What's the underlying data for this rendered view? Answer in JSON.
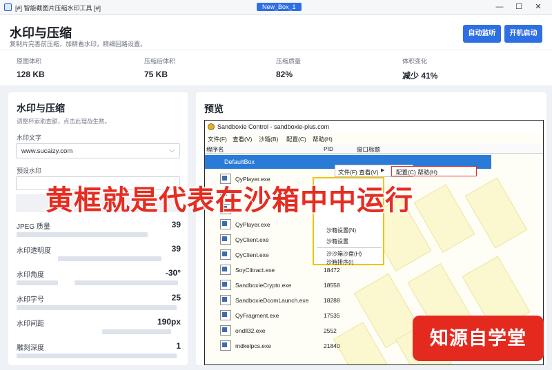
{
  "window": {
    "title": "[#] 智能截图片压缩水印工具 [#]",
    "tab_badge": "New_Box_1",
    "minimize": "—",
    "maximize": "☐",
    "close": "✕"
  },
  "header": {
    "title": "水印与压缩",
    "subtitle": "复制片完善前压缩，加精看水印，精细回路设置。",
    "btn_auto": "自动监听",
    "btn_start": "开机启动"
  },
  "stats": [
    {
      "label": "原图体积",
      "value": "128 KB"
    },
    {
      "label": "压缩后体积",
      "value": "75 KB"
    },
    {
      "label": "压缩质量",
      "value": "82%"
    },
    {
      "label": "体积变化",
      "value": "减少 41%"
    }
  ],
  "left_panel": {
    "title": "水印与压缩",
    "subtitle": "调整杯索助查额，点击此理战生数。",
    "watermark_text_label": "水印文字",
    "watermark_text_value": "www.sucaizy.com",
    "preset_label": "预设水印",
    "rows": [
      {
        "label": "JPEG 质量",
        "value": "39"
      },
      {
        "label": "水印透明度",
        "value": "39"
      },
      {
        "label": "水印角度",
        "value": "-30°"
      },
      {
        "label": "水印字号",
        "value": "25"
      },
      {
        "label": "水印间距",
        "value": "190px"
      },
      {
        "label": "雕刻深度",
        "value": "1"
      }
    ]
  },
  "preview": {
    "title": "预览",
    "sb_title": "Sandboxie Control - sandboxie-plus.com",
    "sb_menu": [
      "文件(F)",
      "查看(V)",
      "沙箱(B)",
      "配置(C)",
      "帮助(H)"
    ],
    "sb_cols": [
      "程序名",
      "PID",
      "窗口标题"
    ],
    "selected_box": "DefaultBox",
    "processes": [
      {
        "name": "QyPlayer.exe",
        "pid": ""
      },
      {
        "name": "",
        "pid": ""
      },
      {
        "name": "",
        "pid": ""
      },
      {
        "name": "QyPlayer.exe",
        "pid": ""
      },
      {
        "name": "QyClient.exe",
        "pid": ""
      },
      {
        "name": "QyClient.exe",
        "pid": ""
      },
      {
        "name": "SoyClitract.exe",
        "pid": "18472"
      },
      {
        "name": "SandboxieCrypto.exe",
        "pid": "18558"
      },
      {
        "name": "SandboxieDcomLaunch.exe",
        "pid": "18288"
      },
      {
        "name": "QyFragment.exe",
        "pid": "17535"
      },
      {
        "name": "ondll32.exe",
        "pid": "2552"
      },
      {
        "name": "mdkelpcs.exe",
        "pid": "21840"
      }
    ],
    "ctx_menu": "文件(F) 查看(V)",
    "ctx_sub": "配置(C) 帮助(H)",
    "yellow_menu": [
      "",
      "",
      "",
      "",
      "沙箱设置(N)",
      "沙箱设置",
      "沙沙箱沙盘(H)",
      "沙箱排序(I)"
    ]
  },
  "overlay_caption": "黄框就是代表在沙箱中中运行",
  "brand": "知源自学堂"
}
